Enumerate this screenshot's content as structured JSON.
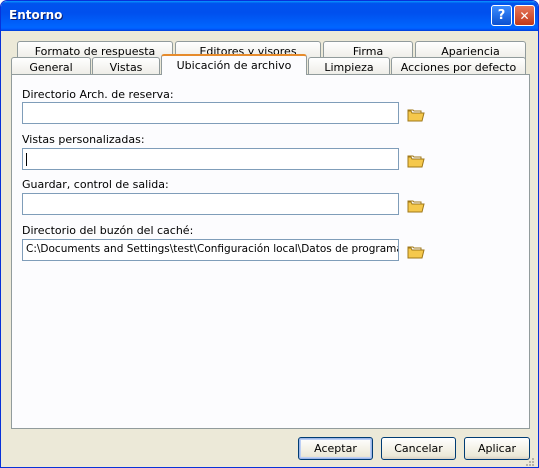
{
  "window": {
    "title": "Entorno",
    "help_glyph": "?",
    "close_glyph": "✕"
  },
  "tabs_back": [
    "Formato de respuesta",
    "Editores y visores",
    "Firma",
    "Apariencia"
  ],
  "tabs_front": [
    "General",
    "Vistas",
    "Ubicación de archivo",
    "Limpieza",
    "Acciones por defecto"
  ],
  "active_tab": "Ubicación de archivo",
  "fields": [
    {
      "label": "Directorio Arch. de reserva:",
      "value": ""
    },
    {
      "label": "Vistas personalizadas:",
      "value": ""
    },
    {
      "label": "Guardar, control de salida:",
      "value": ""
    },
    {
      "label": "Directorio del buzón del caché:",
      "value": "C:\\Documents and Settings\\test\\Configuración local\\Datos de programa\\Nov"
    }
  ],
  "buttons": {
    "ok": "Aceptar",
    "cancel": "Cancelar",
    "apply": "Aplicar"
  },
  "colors": {
    "titlebar": "#0054e3",
    "dialog_bg": "#ece9d8",
    "active_tab_accent": "#e68b2c",
    "folder_icon": "#f5c84c"
  }
}
